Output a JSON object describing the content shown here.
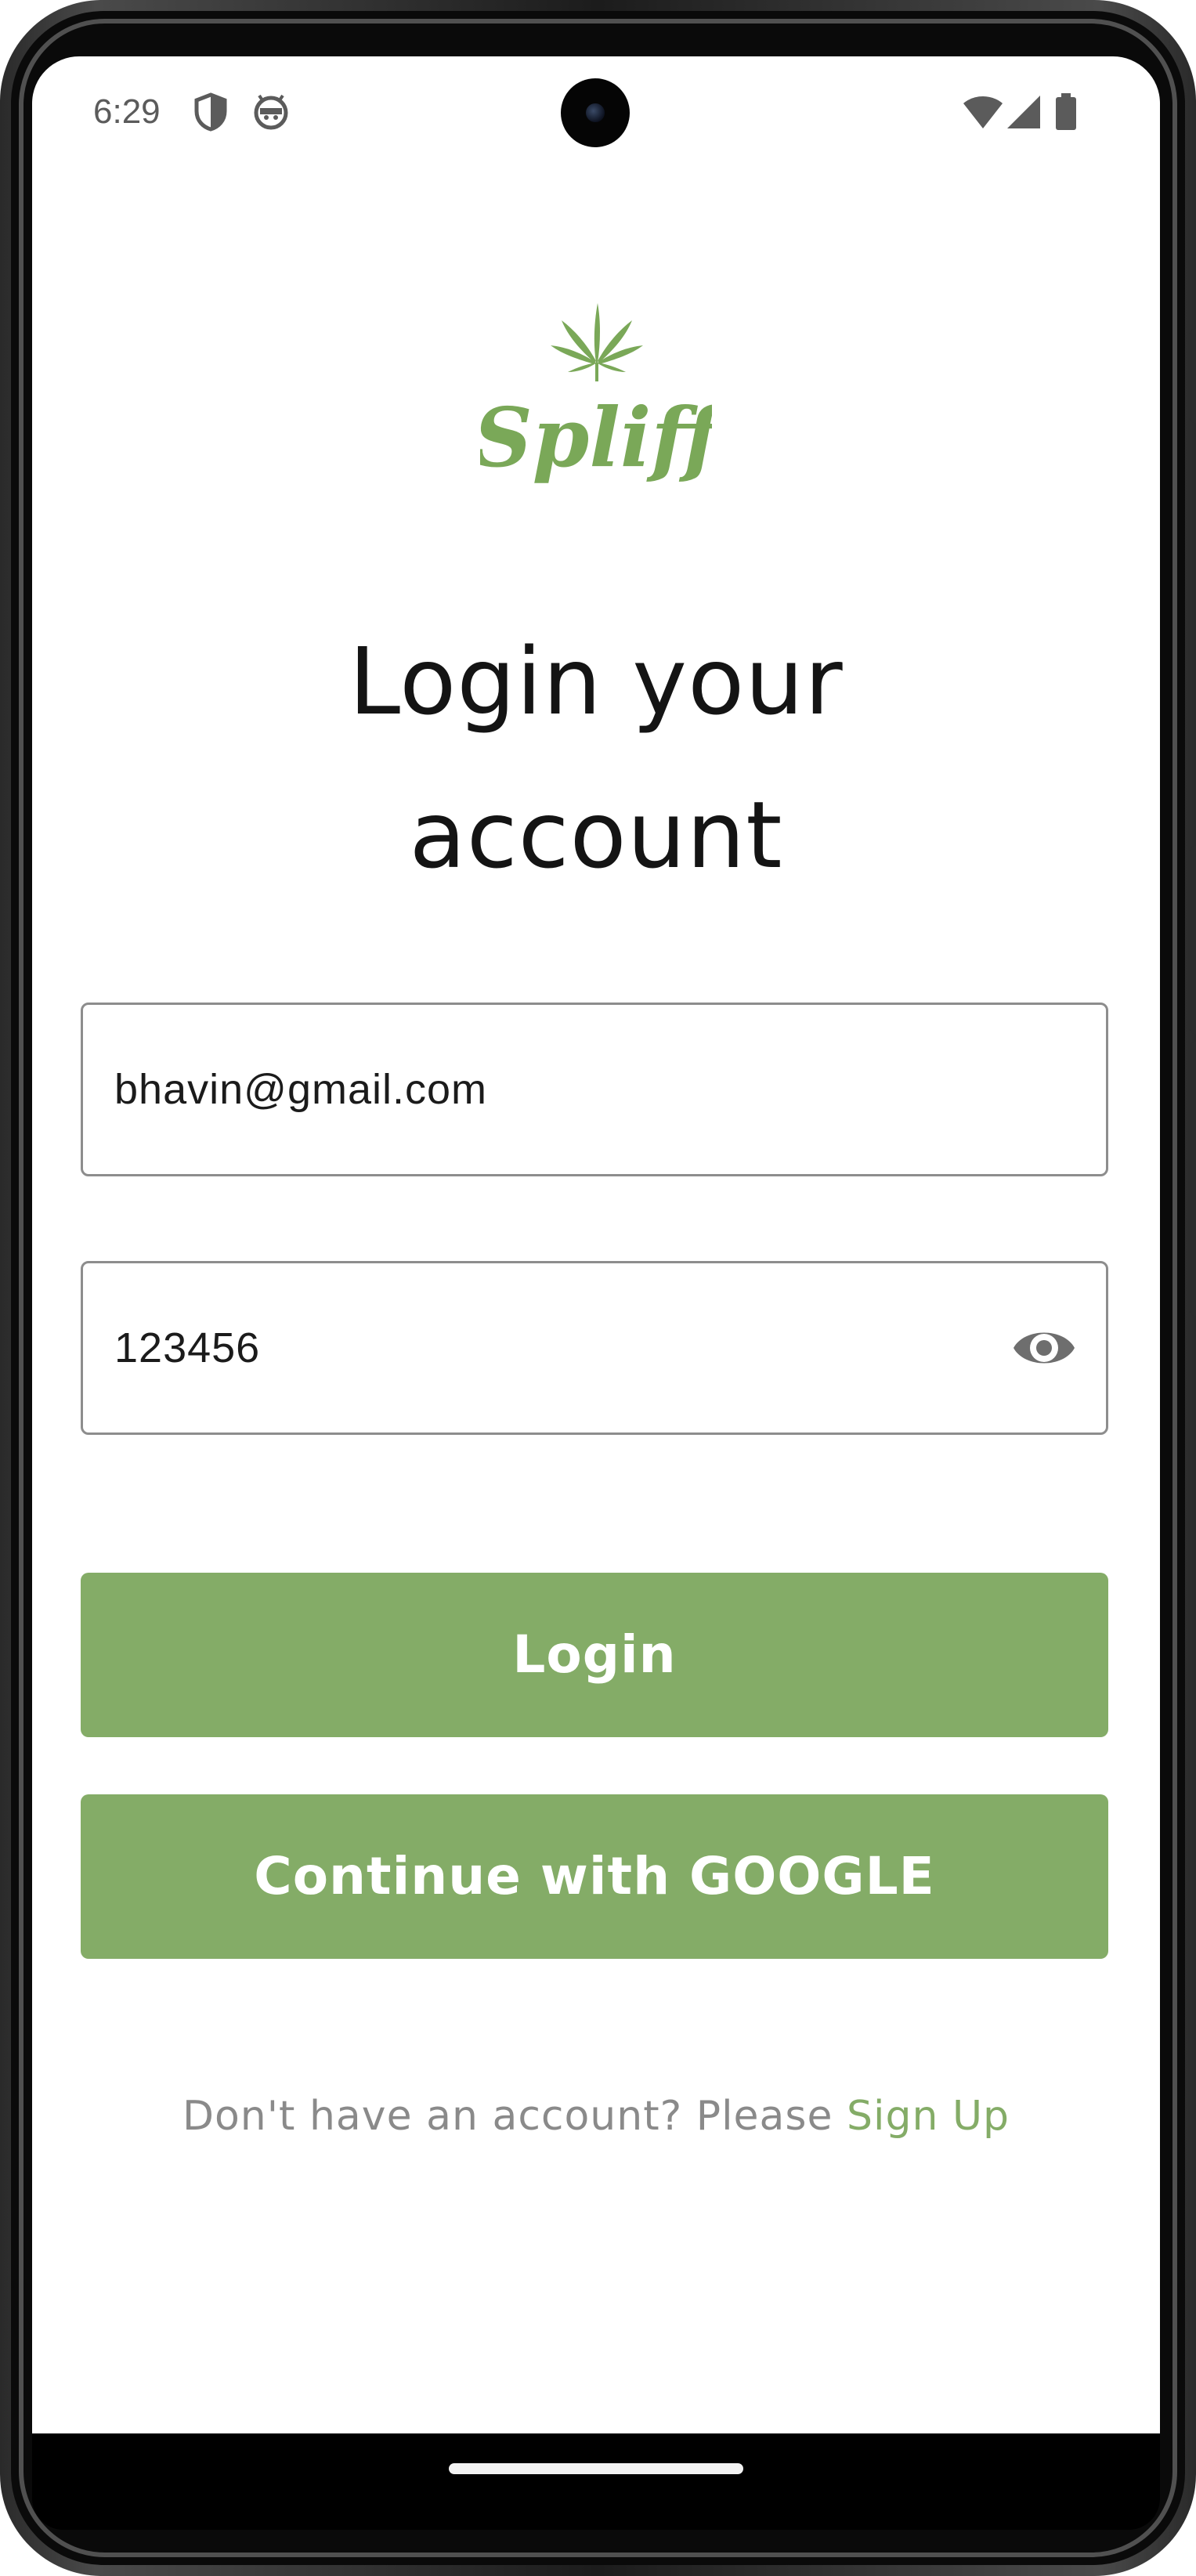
{
  "status_bar": {
    "time": "6:29",
    "left_icons": [
      "shield-icon",
      "android-face-icon"
    ],
    "right_icons": [
      "wifi-icon",
      "cell-signal-icon",
      "battery-icon"
    ]
  },
  "app": {
    "logo_text": "Spliff",
    "brand_color": "#84ac67"
  },
  "login": {
    "title": "Login your\naccount",
    "email_value": "bhavin@gmail.com",
    "password_value": "123456",
    "password_toggle_icon": "eye-icon",
    "login_button": "Login",
    "google_button": "Continue with GOOGLE",
    "signup_prompt": "Don't have an account? Please ",
    "signup_link": "Sign Up"
  }
}
